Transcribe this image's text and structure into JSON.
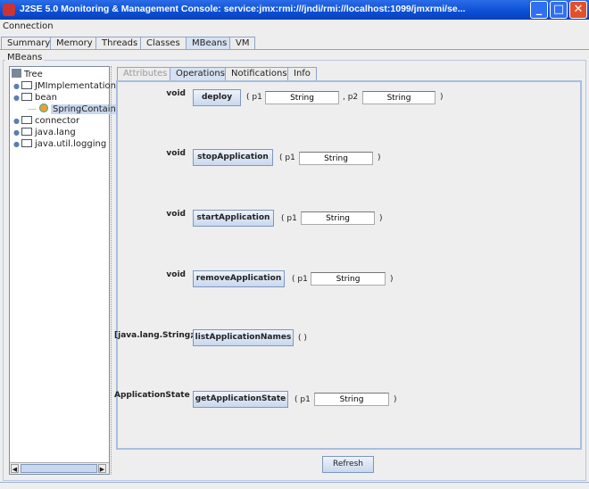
{
  "window": {
    "title": "J2SE 5.0 Monitoring & Management Console: service:jmx:rmi:///jndi/rmi://localhost:1099/jmxrmi/se...",
    "minimize": "_",
    "maximize": "□",
    "close": "✕"
  },
  "menu": {
    "connection": "Connection"
  },
  "main_tabs": [
    "Summary",
    "Memory",
    "Threads",
    "Classes",
    "MBeans",
    "VM"
  ],
  "selected_main_tab": "MBeans",
  "group_label": "MBeans",
  "tree": {
    "root": "Tree",
    "nodes": [
      "JMImplementation",
      "bean",
      "SpringContainer",
      "connector",
      "java.lang",
      "java.util.logging"
    ]
  },
  "op_tabs": [
    "Attributes",
    "Operations",
    "Notifications",
    "Info"
  ],
  "selected_op_tab": "Operations",
  "operations": [
    {
      "ret": "void",
      "name": "deploy",
      "params": [
        {
          "label": "( p1",
          "value": "String"
        },
        {
          "label": ", p2",
          "value": "String"
        }
      ],
      "close": ")"
    },
    {
      "ret": "void",
      "name": "stopApplication",
      "params": [
        {
          "label": "( p1",
          "value": "String"
        }
      ],
      "close": ")"
    },
    {
      "ret": "void",
      "name": "startApplication",
      "params": [
        {
          "label": "( p1",
          "value": "String"
        }
      ],
      "close": ")"
    },
    {
      "ret": "void",
      "name": "removeApplication",
      "params": [
        {
          "label": "( p1",
          "value": "String"
        }
      ],
      "close": ")"
    },
    {
      "ret": "[java.lang.String;]",
      "name": "listApplicationNames",
      "params": [],
      "close": "( )"
    },
    {
      "ret": "ApplicationState",
      "name": "getApplicationState",
      "params": [
        {
          "label": "( p1",
          "value": "String"
        }
      ],
      "close": ")"
    }
  ],
  "refresh_label": "Refresh"
}
